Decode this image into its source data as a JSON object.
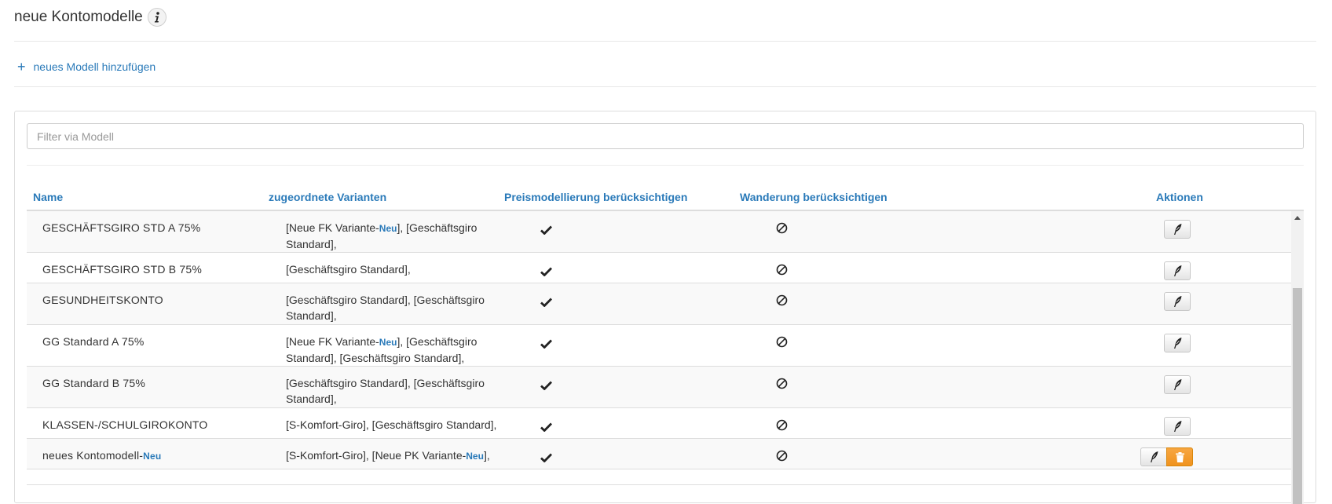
{
  "page": {
    "title": "neue Kontomodelle",
    "info_icon": "info-icon",
    "add_model_label": "neues Modell hinzufügen"
  },
  "filter": {
    "placeholder": "Filter via Modell",
    "value": ""
  },
  "table": {
    "headers": {
      "name": "Name",
      "variants": "zugeordnete Varianten",
      "price": "Preismodellierung berücksichtigen",
      "migration": "Wanderung berücksichtigen",
      "actions": "Aktionen"
    },
    "rows": [
      {
        "name": "GESCHÄFTSGIRO STD A 75%",
        "variants": [
          {
            "text": "[Neue FK Variante-"
          },
          {
            "text": "Neu",
            "badge": true
          },
          {
            "text": "], [Geschäftsgiro Standard],"
          }
        ],
        "price_icon": "check-icon",
        "migration_icon": "ban-icon",
        "deletable": false
      },
      {
        "name": "GESCHÄFTSGIRO STD B 75%",
        "variants": [
          {
            "text": "[Geschäftsgiro Standard],"
          }
        ],
        "price_icon": "check-icon",
        "migration_icon": "ban-icon",
        "deletable": false
      },
      {
        "name": "GESUNDHEITSKONTO",
        "variants": [
          {
            "text": "[Geschäftsgiro Standard], [Geschäftsgiro Standard],"
          }
        ],
        "price_icon": "check-icon",
        "migration_icon": "ban-icon",
        "deletable": false
      },
      {
        "name": "GG Standard A 75%",
        "variants": [
          {
            "text": "[Neue FK Variante-"
          },
          {
            "text": "Neu",
            "badge": true
          },
          {
            "text": "], [Geschäftsgiro Standard], [Geschäftsgiro Standard],"
          }
        ],
        "price_icon": "check-icon",
        "migration_icon": "ban-icon",
        "deletable": false
      },
      {
        "name": "GG Standard B 75%",
        "variants": [
          {
            "text": "[Geschäftsgiro Standard], [Geschäftsgiro Standard],"
          }
        ],
        "price_icon": "check-icon",
        "migration_icon": "ban-icon",
        "deletable": false
      },
      {
        "name": "KLASSEN-/SCHULGIROKONTO",
        "variants": [
          {
            "text": "[S-Komfort-Giro], [Geschäftsgiro Standard],"
          }
        ],
        "price_icon": "check-icon",
        "migration_icon": "ban-icon",
        "deletable": false
      },
      {
        "name": "neues Kontomodell-",
        "name_badge": "Neu",
        "variants": [
          {
            "text": "[S-Komfort-Giro], [Neue PK Variante-"
          },
          {
            "text": "Neu",
            "badge": true
          },
          {
            "text": "],"
          }
        ],
        "price_icon": "check-icon",
        "migration_icon": "ban-icon",
        "deletable": true
      }
    ]
  },
  "colors": {
    "link": "#2a7ab9",
    "delete_button": "#f0931e",
    "row_stripe": "#f9f9f9"
  }
}
